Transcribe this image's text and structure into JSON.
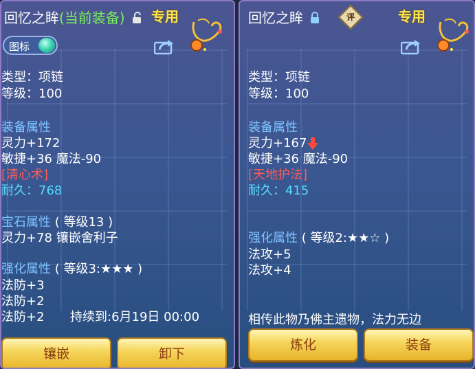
{
  "left": {
    "title_name": "回忆之眸",
    "title_equipped": "(当前装备)",
    "exclusive": "专用",
    "toggle_label": "图标",
    "type_line": "类型：项链",
    "level_line": "等级：100",
    "equip_attr_title": "装备属性",
    "attr_1": "灵力+172",
    "attr_2": "敏捷+36 魔法-90",
    "skill": "[清心术]",
    "durability": "耐久：768",
    "gem_title": "宝石属性",
    "gem_level": "( 等级13 )",
    "gem_attr": "灵力+78 镶嵌舍利子",
    "enhance_title": "强化属性",
    "enhance_level": "( 等级3:★★★ )",
    "enh_1": "法防+3",
    "enh_2": "法防+2",
    "enh_3": "法防+2",
    "duration": "持续到:6月19日 00:00",
    "btn_inlay": "镶嵌",
    "btn_unload": "卸下"
  },
  "right": {
    "title_name": "回忆之眸",
    "rate_badge": "评",
    "exclusive": "专用",
    "type_line": "类型：项链",
    "level_line": "等级：100",
    "equip_attr_title": "装备属性",
    "attr_1": "灵力+167",
    "attr_2": "敏捷+36 魔法-90",
    "skill": "[天地护法]",
    "durability": "耐久：415",
    "enhance_title": "强化属性",
    "enhance_level": "( 等级2:★★☆ )",
    "enh_1": "法攻+5",
    "enh_2": "法攻+4",
    "lore": "相传此物乃佛主遗物，法力无边",
    "btn_refine": "炼化",
    "btn_equip": "装备"
  },
  "colors": {
    "equipped_green": "#7cf25a",
    "exclusive_yellow": "#ffe64a",
    "section_blue": "#7fc3ff",
    "skill_red": "#ff5a5a",
    "durability_cyan": "#56dcff",
    "button_gold": "#f6d65c"
  },
  "icons": {
    "left_lock": "unlocked-padlock-icon",
    "right_lock": "locked-padlock-icon",
    "share": "share-icon",
    "necklace": "necklace-icon",
    "stat_down": "red-down-arrow-icon"
  }
}
